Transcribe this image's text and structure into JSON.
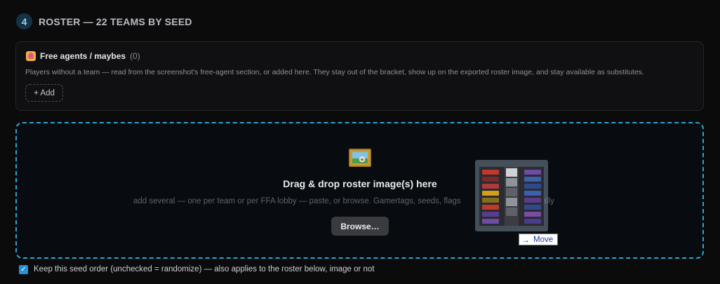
{
  "section": {
    "step_number": "4",
    "title": "ROSTER — 22 TEAMS BY SEED"
  },
  "free_agents": {
    "title": "Free agents / maybes",
    "count": "(0)",
    "description": "Players without a team — read from the screenshot's free-agent section, or added here. They stay out of the bracket, show up on the exported roster image, and stay available as substitutes.",
    "add_label": "+ Add"
  },
  "dropzone": {
    "title": "Drag & drop roster image(s) here",
    "subtitle": "add several — one per team or per FFA lobby — paste, or browse. Gamertags, seeds, flags",
    "subtitle_tail": "automatically",
    "browse_label": "Browse…",
    "icon": "framed-picture-icon"
  },
  "drag": {
    "tooltip_label": "Move",
    "tooltip_icon": "arrow-right-icon"
  },
  "seed_order": {
    "checked": true,
    "label": "Keep this seed order (unchecked = randomize) — also applies to the roster below, image or not"
  },
  "colors": {
    "accent": "#2aa6d1",
    "checkbox": "#2b8fd6",
    "badge_bg": "#163246"
  }
}
